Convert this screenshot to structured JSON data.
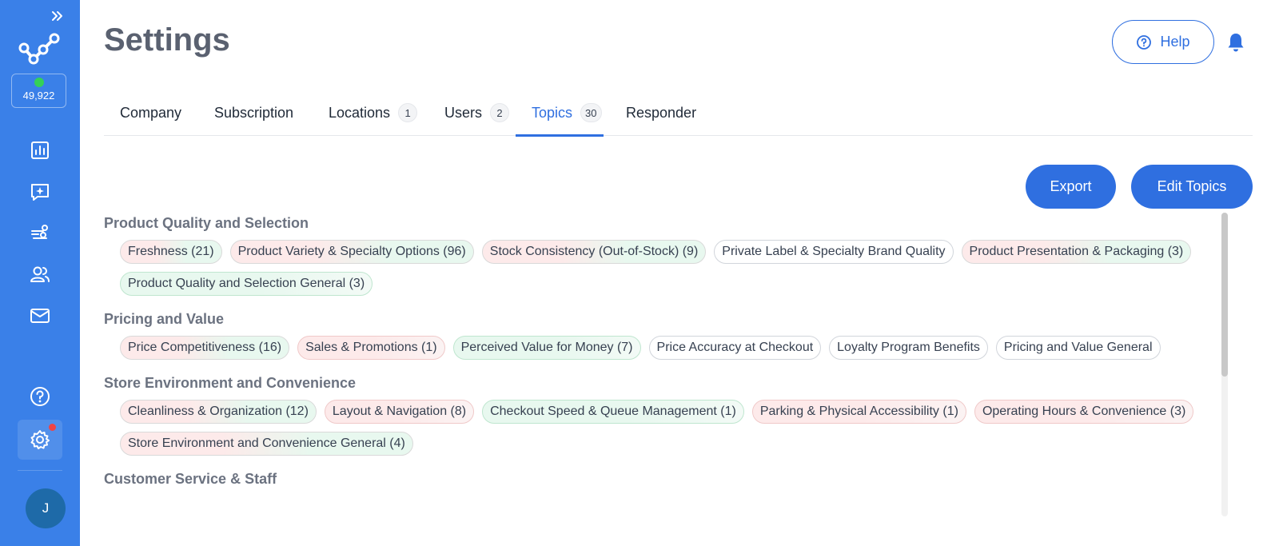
{
  "sidebar": {
    "credits": "49,922",
    "avatar_initial": "J"
  },
  "header": {
    "title": "Settings",
    "help_label": "Help"
  },
  "tabs": [
    {
      "label": "Company",
      "count": ""
    },
    {
      "label": "Subscription",
      "count": ""
    },
    {
      "label": "Locations",
      "count": "1"
    },
    {
      "label": "Users",
      "count": "2"
    },
    {
      "label": "Topics",
      "count": "30"
    },
    {
      "label": "Responder",
      "count": ""
    }
  ],
  "actions": {
    "export_label": "Export",
    "edit_label": "Edit Topics"
  },
  "sections": [
    {
      "title": "Product Quality and Selection",
      "chips": [
        {
          "label": "Freshness (21)",
          "tone": "mix"
        },
        {
          "label": "Product Variety & Specialty Options (96)",
          "tone": "mix"
        },
        {
          "label": "Stock Consistency (Out-of-Stock) (9)",
          "tone": "mix"
        },
        {
          "label": "Private Label & Specialty Brand Quality",
          "tone": "neu"
        },
        {
          "label": "Product Presentation & Packaging (3)",
          "tone": "mix"
        },
        {
          "label": "Product Quality and Selection General (3)",
          "tone": "pos"
        }
      ]
    },
    {
      "title": "Pricing and Value",
      "chips": [
        {
          "label": "Price Competitiveness (16)",
          "tone": "mix"
        },
        {
          "label": "Sales & Promotions (1)",
          "tone": "neg"
        },
        {
          "label": "Perceived Value for Money (7)",
          "tone": "pos"
        },
        {
          "label": "Price Accuracy at Checkout",
          "tone": "neu"
        },
        {
          "label": "Loyalty Program Benefits",
          "tone": "neu"
        },
        {
          "label": "Pricing and Value General",
          "tone": "neu"
        }
      ]
    },
    {
      "title": "Store Environment and Convenience",
      "chips": [
        {
          "label": "Cleanliness & Organization (12)",
          "tone": "mix"
        },
        {
          "label": "Layout & Navigation (8)",
          "tone": "neg"
        },
        {
          "label": "Checkout Speed & Queue Management (1)",
          "tone": "pos"
        },
        {
          "label": "Parking & Physical Accessibility (1)",
          "tone": "neg"
        },
        {
          "label": "Operating Hours & Convenience (3)",
          "tone": "neg"
        },
        {
          "label": "Store Environment and Convenience General (4)",
          "tone": "mix"
        }
      ]
    },
    {
      "title": "Customer Service & Staff",
      "chips": []
    }
  ],
  "colors": {
    "sidebar": "#3a80e8",
    "accent": "#2f6fe0",
    "negative_tint": "#fdeaea",
    "positive_tint": "#e8f8ef"
  }
}
